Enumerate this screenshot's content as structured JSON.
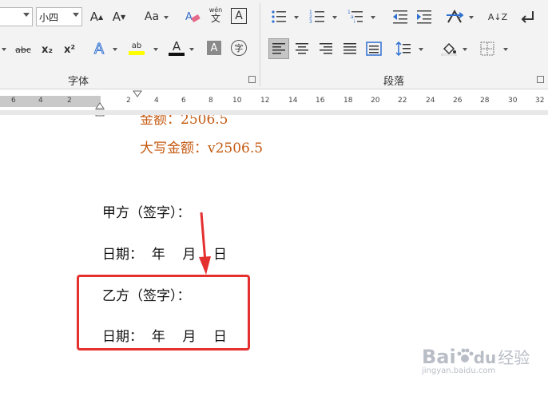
{
  "font_group": {
    "font_name_value": "",
    "font_size_value": "小四",
    "label": "字体",
    "buttons": {
      "grow": "A",
      "shrink": "A",
      "change_case": "Aa",
      "phonetic_top": "wén",
      "phonetic_bottom": "文",
      "char_border": "A",
      "strikethrough": "abc",
      "subscript": "x₂",
      "superscript": "x²",
      "text_effect": "A",
      "highlight": "ab",
      "font_color": "A",
      "char_shading": "A",
      "enclose": "字"
    }
  },
  "paragraph_group": {
    "label": "段落",
    "sort": "A↓Z"
  },
  "ruler": {
    "left_numbers": [
      "6",
      "4",
      "2"
    ],
    "right_numbers": [
      "2",
      "4",
      "6",
      "8",
      "10",
      "12",
      "14",
      "16",
      "18",
      "20",
      "22",
      "24",
      "26",
      "28",
      "30",
      "32"
    ]
  },
  "document": {
    "line_amount_cut": "金额：2506.5",
    "line_amount_upper": "大写金额：v2506.5",
    "party_a_sign": "甲方（签字）：",
    "date_1": "日期：  年    月    日",
    "party_b_sign": "乙方（签字）：",
    "date_2": "日期：  年    月    日"
  },
  "watermark": {
    "brand": "Bai",
    "brand2": "du",
    "brand_cn": "经验",
    "url": "jingyan.baidu.com"
  },
  "colors": {
    "accent_red": "#e53030",
    "amount_text": "#c55a11",
    "highlight_yellow": "#ffff00",
    "font_color_red": "#e00000"
  }
}
